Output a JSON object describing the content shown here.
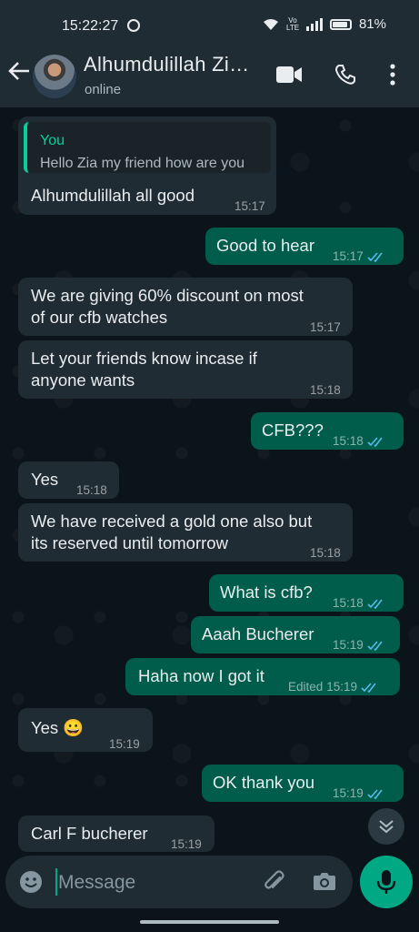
{
  "status_bar": {
    "time": "15:22:27",
    "battery": "81%",
    "volte": "Vo LTE"
  },
  "header": {
    "name": "Alhumdulillah Zi…",
    "status": "online"
  },
  "messages": [
    {
      "dir": "in",
      "quote_author": "You",
      "quote_text": "Hello Zia my friend how are you",
      "text": "Alhumdulillah all good",
      "time": "15:17"
    },
    {
      "dir": "out",
      "text": "Good to hear",
      "time": "15:17"
    },
    {
      "dir": "in",
      "lines": [
        "We are giving 60% discount on most",
        "of our cfb watches"
      ],
      "time": "15:17"
    },
    {
      "dir": "in",
      "lines": [
        "Let your friends know incase if",
        "anyone wants"
      ],
      "time": "15:18"
    },
    {
      "dir": "out",
      "text": "CFB???",
      "time": "15:18"
    },
    {
      "dir": "in",
      "text": "Yes",
      "time": "15:18"
    },
    {
      "dir": "in",
      "lines": [
        "We have received a gold one also but",
        "its reserved until tomorrow"
      ],
      "time": "15:18"
    },
    {
      "dir": "out",
      "text": "What is cfb?",
      "time": "15:18"
    },
    {
      "dir": "out",
      "text": "Aaah Bucherer",
      "time": "15:19"
    },
    {
      "dir": "out",
      "text": "Haha now I got it",
      "edited": "Edited",
      "time": "15:19"
    },
    {
      "dir": "in",
      "text": "Yes 😀",
      "time": "15:19"
    },
    {
      "dir": "out",
      "text": "OK thank you",
      "time": "15:19"
    },
    {
      "dir": "in",
      "text": "Carl F bucherer",
      "time": "15:19"
    }
  ],
  "input": {
    "placeholder": "Message"
  },
  "icons": {
    "back": "arrow-left-icon",
    "video": "video-call-icon",
    "call": "phone-icon",
    "menu": "more-vertical-icon",
    "emoji": "emoji-icon",
    "attach": "paperclip-icon",
    "camera": "camera-icon",
    "mic": "microphone-icon",
    "scroll": "chevron-double-down-icon",
    "ticks": "double-check-icon"
  },
  "colors": {
    "incoming": "#202c33",
    "outgoing": "#005c4b",
    "accent": "#00a884",
    "read_ticks": "#53bdeb",
    "background": "#0b141a"
  }
}
